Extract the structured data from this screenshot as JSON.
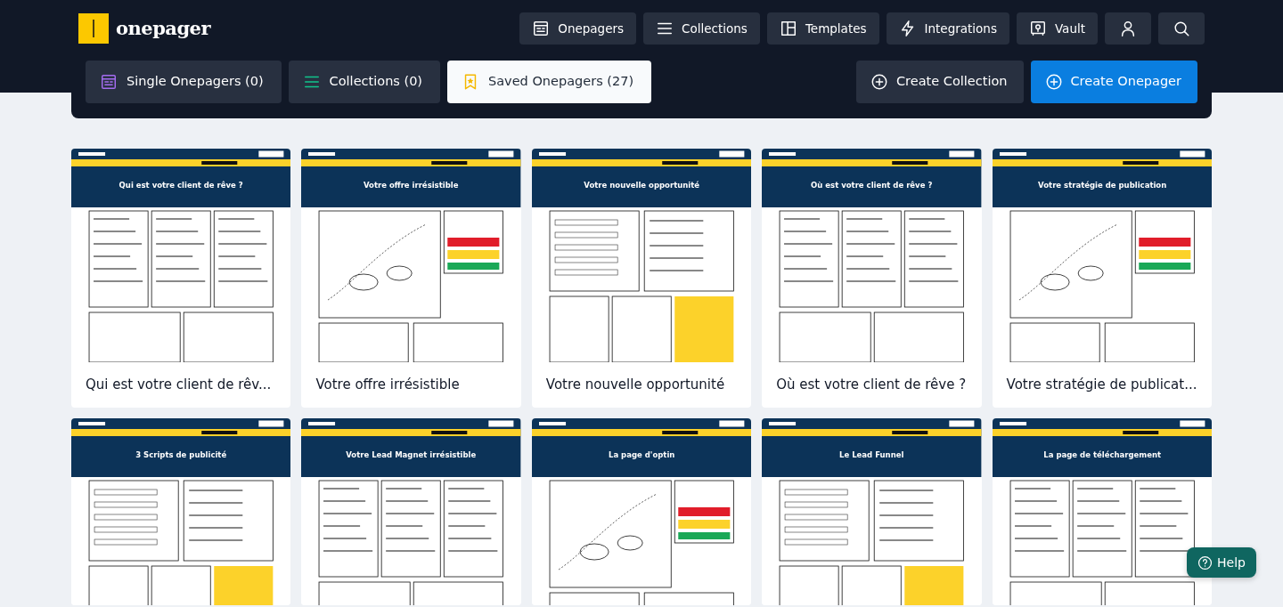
{
  "brand": "onepager",
  "nav": [
    {
      "label": "Onepagers"
    },
    {
      "label": "Collections"
    },
    {
      "label": "Templates"
    },
    {
      "label": "Integrations"
    },
    {
      "label": "Vault"
    }
  ],
  "tabs": [
    {
      "label": "Single Onepagers (0)",
      "selected": false
    },
    {
      "label": "Collections (0)",
      "selected": false
    },
    {
      "label": "Saved Onepagers (27)",
      "selected": true
    }
  ],
  "actions": [
    {
      "label": "Create Collection",
      "kind": "secondary"
    },
    {
      "label": "Create Onepager",
      "kind": "primary"
    }
  ],
  "cards": [
    {
      "thumb_title": "Qui est votre client de rêve ?",
      "title": "Qui est votre client de rêv..."
    },
    {
      "thumb_title": "Votre offre irrésistible",
      "title": "Votre offre irrésistible"
    },
    {
      "thumb_title": "Votre nouvelle opportunité",
      "title": "Votre nouvelle opportunité"
    },
    {
      "thumb_title": "Où est votre client de rêve ?",
      "title": "Où est votre client de rêve ?"
    },
    {
      "thumb_title": "Votre stratégie de publication",
      "title": "Votre stratégie de publicat..."
    },
    {
      "thumb_title": "3 Scripts de publicité"
    },
    {
      "thumb_title": "Votre Lead Magnet irrésistible"
    },
    {
      "thumb_title": "La page d'optin"
    },
    {
      "thumb_title": "Le Lead Funnel"
    },
    {
      "thumb_title": "La page de téléchargement"
    }
  ],
  "help": {
    "label": "Help"
  }
}
